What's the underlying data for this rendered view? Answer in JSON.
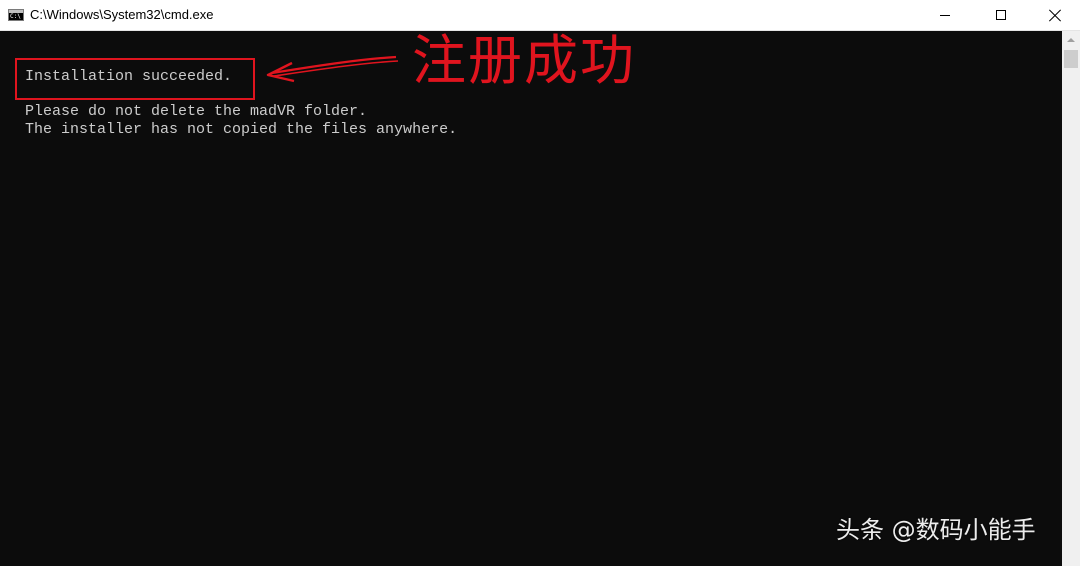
{
  "window": {
    "title": "C:\\Windows\\System32\\cmd.exe",
    "icon": "cmd-icon",
    "icon_glyph": "C:\\"
  },
  "controls": {
    "minimize": "minimize-icon",
    "maximize": "maximize-icon",
    "close": "close-icon"
  },
  "console": {
    "background": "#0c0c0c",
    "text_color": "#cccccc",
    "lines": [
      "Installation succeeded.",
      "Please do not delete the madVR folder.",
      "The installer has not copied the files anywhere."
    ]
  },
  "annotation": {
    "text": "注册成功",
    "color": "#e0141e"
  },
  "watermark": {
    "text": "头条 @数码小能手"
  },
  "scrollbar": {
    "up_icon": "scroll-up-arrow-icon"
  }
}
